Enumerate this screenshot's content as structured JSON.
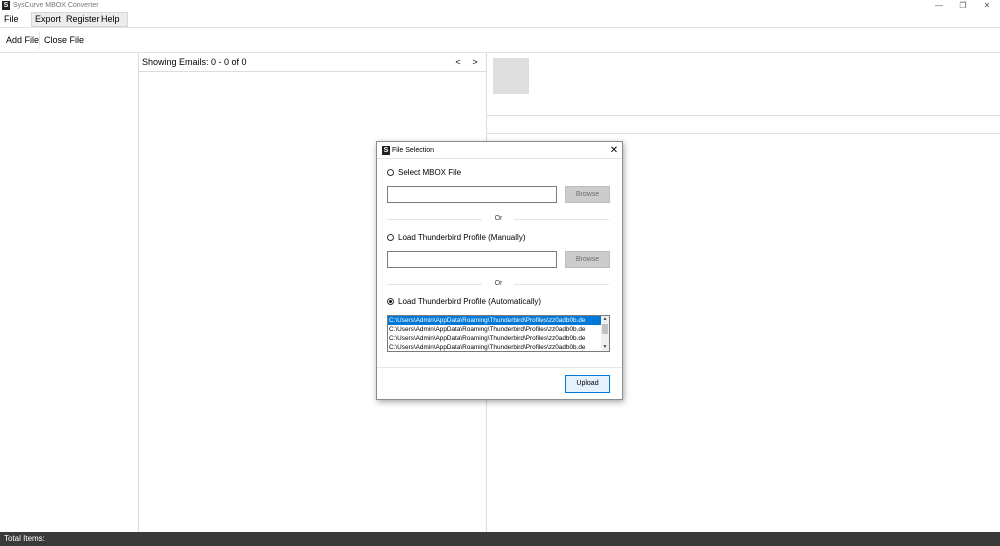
{
  "app": {
    "title": "SysCurve MBOX Converter",
    "logo": "S"
  },
  "window_controls": {
    "minimize": "—",
    "restore": "❐",
    "close": "✕"
  },
  "menu": {
    "items": [
      "File",
      "Export",
      "Register",
      "Help"
    ]
  },
  "toolbar": {
    "add_file": "Add File",
    "close_file": "Close File"
  },
  "email_list": {
    "showing": "Showing Emails: 0 - 0 of 0",
    "prev": "<",
    "next": ">"
  },
  "status_bar": {
    "label": "Total Items:"
  },
  "dialog": {
    "title": "File Selection",
    "logo": "S",
    "close": "✕",
    "option_mbox": "Select MBOX File",
    "mbox_path": "",
    "browse_label": "Browse",
    "or_label": "Or",
    "option_manual": "Load Thunderbird Profile (Manually)",
    "manual_path": "",
    "option_auto": "Load Thunderbird Profile (Automatically)",
    "selected_option": "auto",
    "profiles": [
      "C:\\Users\\Admin\\AppData\\Roaming\\Thunderbird\\Profiles\\zz0adb0b.de",
      "C:\\Users\\Admin\\AppData\\Roaming\\Thunderbird\\Profiles\\zz0adb0b.de",
      "C:\\Users\\Admin\\AppData\\Roaming\\Thunderbird\\Profiles\\zz0adb0b.de",
      "C:\\Users\\Admin\\AppData\\Roaming\\Thunderbird\\Profiles\\zz0adb0b.de"
    ],
    "upload_label": "Upload"
  },
  "colors": {
    "selection": "#0078d7",
    "status_bar": "#3a3a3a",
    "button_disabled": "#cccccc"
  }
}
